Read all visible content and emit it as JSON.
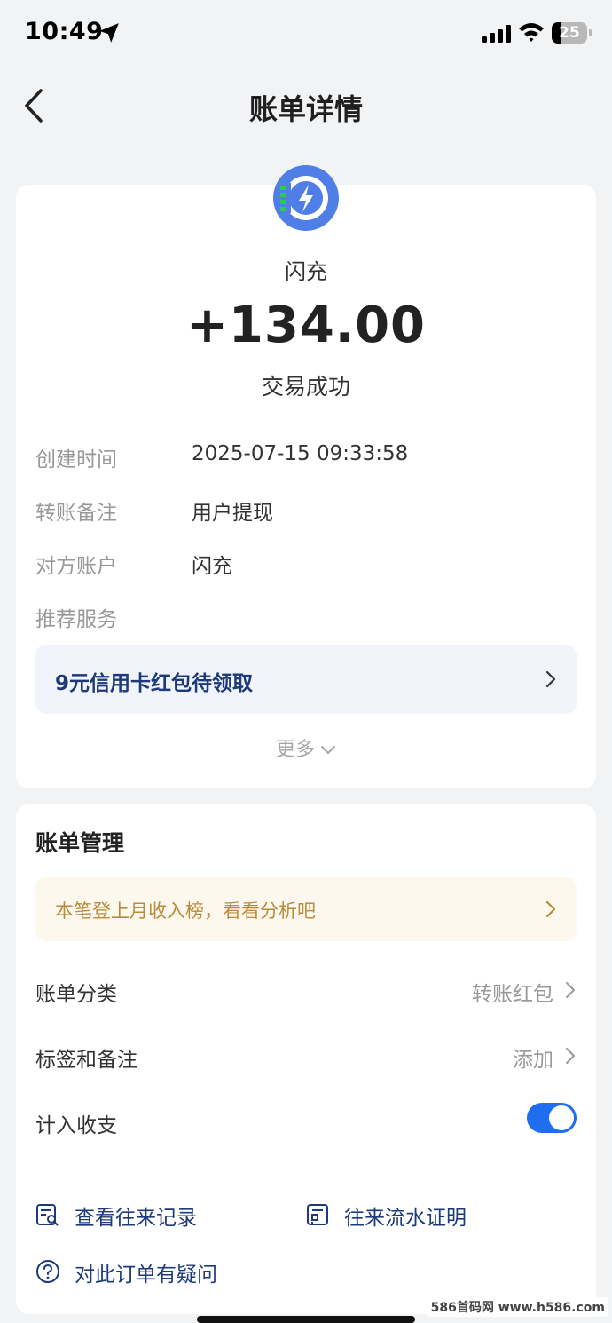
{
  "status_bar": {
    "time": "10:49",
    "battery": "25"
  },
  "nav": {
    "title": "账单详情"
  },
  "detail": {
    "merchant": "闪充",
    "amount": "+134.00",
    "status": "交易成功",
    "rows": [
      {
        "label": "创建时间",
        "value": "2025-07-15 09:33:58"
      },
      {
        "label": "转账备注",
        "value": "用户提现"
      },
      {
        "label": "对方账户",
        "value": "闪充"
      },
      {
        "label": "推荐服务",
        "value": ""
      }
    ],
    "promo": "9元信用卡红包待领取",
    "more": "更多"
  },
  "manage": {
    "title": "账单管理",
    "insight": "本笔登上月收入榜，看看分析吧",
    "category_label": "账单分类",
    "category_value": "转账红包",
    "tags_label": "标签和备注",
    "tags_value": "添加",
    "count_label": "计入收支",
    "count_enabled": true,
    "actions": {
      "history": "查看往来记录",
      "certificate": "往来流水证明",
      "question": "对此订单有疑问"
    }
  },
  "watermark": "586首码网 www.h586.com",
  "colors": {
    "accent": "#1f6df0",
    "link": "#1d3b7a",
    "insight": "#b98b3c",
    "logo": "#4f7fe6",
    "logo_green": "#2ecc40"
  }
}
